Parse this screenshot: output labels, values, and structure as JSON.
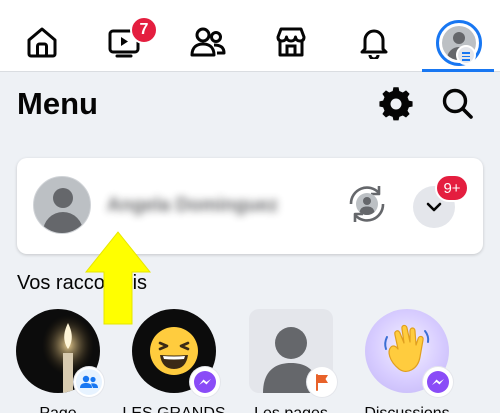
{
  "nav": {
    "items": [
      {
        "id": "home",
        "icon": "home-icon"
      },
      {
        "id": "video",
        "icon": "video-icon",
        "badge": "7"
      },
      {
        "id": "friends",
        "icon": "friends-icon"
      },
      {
        "id": "marketplace",
        "icon": "marketplace-icon"
      },
      {
        "id": "notifications",
        "icon": "bell-icon"
      },
      {
        "id": "menu",
        "icon": "profile-menu-icon",
        "active": true
      }
    ],
    "accent": "#1877f2",
    "badge_color": "#e41e3f"
  },
  "header": {
    "title": "Menu",
    "settings_icon": "gear-icon",
    "search_icon": "search-icon"
  },
  "profile_card": {
    "name": "Angela Dominguez",
    "name_blurred": true,
    "switch_icon": "switch-profile-icon",
    "expand_icon": "chevron-down-icon",
    "badge": "9+"
  },
  "shortcuts": {
    "title": "Vos raccourcis",
    "items": [
      {
        "label": "Page",
        "badge_icon": "group-icon"
      },
      {
        "label": "LES GRANDS",
        "badge_icon": "messenger-icon"
      },
      {
        "label": "Les pages",
        "badge_icon": "flag-icon"
      },
      {
        "label": "Discussions",
        "badge_icon": "messenger-icon"
      }
    ]
  },
  "annotation": {
    "icon": "yellow-up-arrow",
    "color": "#ffff00"
  }
}
